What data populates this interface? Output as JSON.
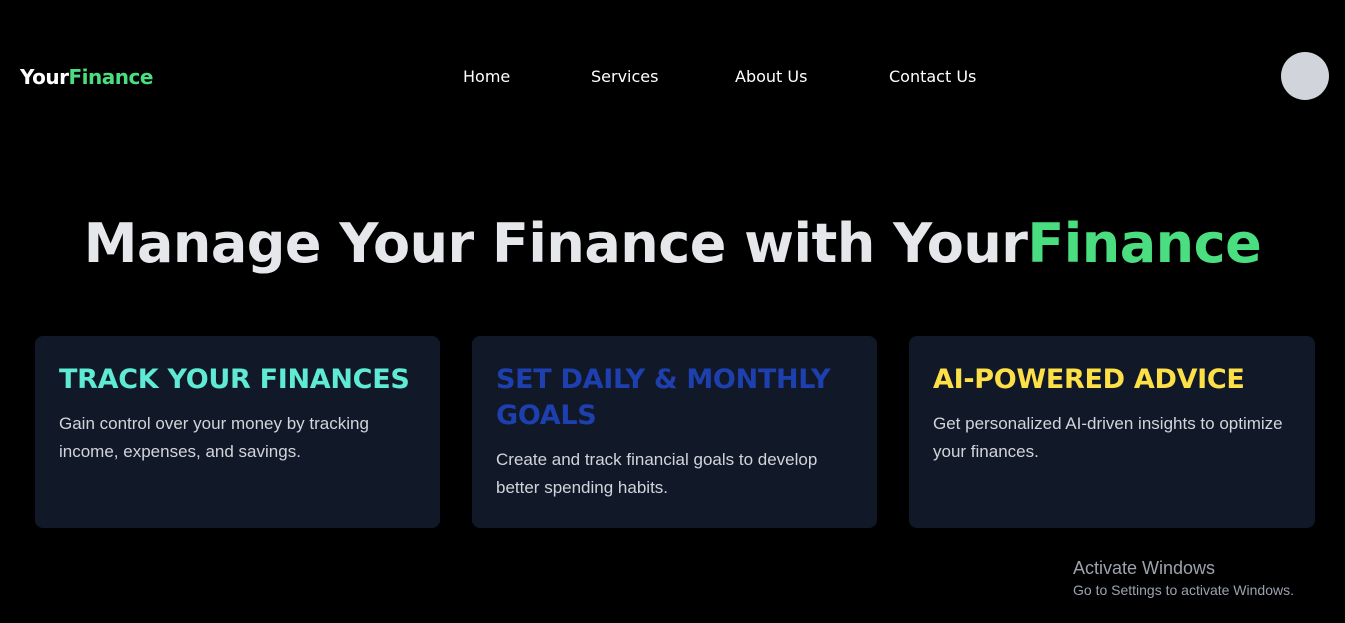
{
  "header": {
    "logo_part1": "Your",
    "logo_part2": "Finance",
    "nav": [
      "Home",
      "Services",
      "About Us",
      "Contact Us"
    ]
  },
  "hero": {
    "title_main": "Manage Your Finance with Your",
    "title_accent": "Finance"
  },
  "cards": [
    {
      "title": "TRACK YOUR FINANCES",
      "text": "Gain control over your money by tracking income, expenses, and savings.",
      "color": "#5eead4"
    },
    {
      "title": "SET DAILY & MONTHLY GOALS",
      "text": "Create and track financial goals to develop better spending habits.",
      "color": "#1e40af"
    },
    {
      "title": "AI-POWERED ADVICE",
      "text": "Get personalized AI-driven insights to optimize your finances.",
      "color": "#fde047"
    }
  ],
  "watermark": {
    "line1": "Activate Windows",
    "line2": "Go to Settings to activate Windows."
  },
  "colors": {
    "background": "#000000",
    "accent_green": "#4ade80",
    "card_bg": "#111827",
    "avatar": "#d1d5db"
  }
}
